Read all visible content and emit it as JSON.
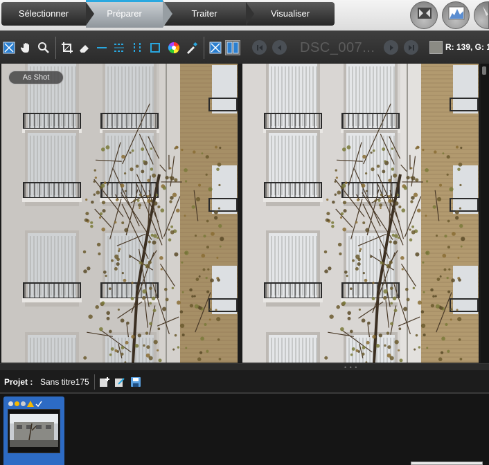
{
  "workflow_tabs": [
    {
      "label": "Sélectionner",
      "active": false
    },
    {
      "label": "Préparer",
      "active": true
    },
    {
      "label": "Traiter",
      "active": false
    },
    {
      "label": "Visualiser",
      "active": false
    }
  ],
  "top_tools": [
    "workspace-icon",
    "histogram-icon",
    "brush-icon"
  ],
  "toolbar": {
    "left_tools": [
      "compare-icon",
      "hand-icon",
      "zoom-icon",
      "crop-icon",
      "eraser-icon",
      "horizon-icon",
      "fit-width-icon",
      "fit-height-icon",
      "fit-frame-icon",
      "color-wheel-icon",
      "eyedropper-icon",
      "single-view-icon",
      "split-view-icon"
    ],
    "filename": "DSC_007...",
    "readout": "R: 139, G: 1",
    "swatch_color": "#8b8b84",
    "accent_color": "#29a8e0"
  },
  "viewer": {
    "preset_badge": "As Shot"
  },
  "project": {
    "label": "Projet :",
    "name": "Sans titre175"
  },
  "filmstrip": {
    "selected_color": "#2d6bc4"
  }
}
